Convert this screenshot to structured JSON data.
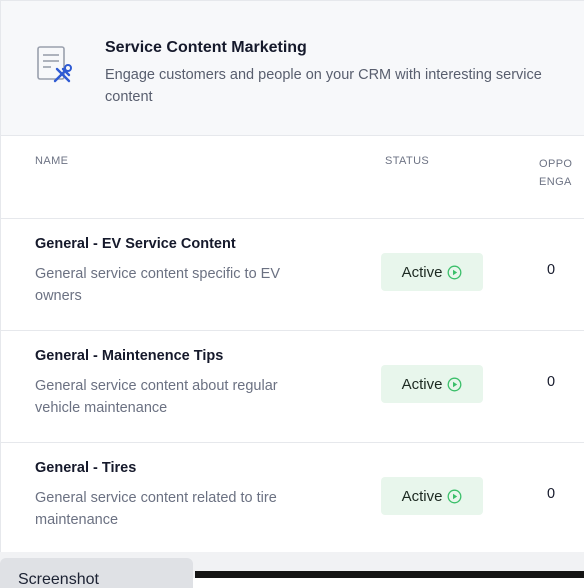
{
  "header": {
    "title": "Service Content Marketing",
    "description": "Engage customers and people on your CRM with interesting service content",
    "icon": "document-tools-icon"
  },
  "table": {
    "columns": [
      "NAME",
      "STATUS",
      "OPPO\nENGA"
    ],
    "rows": [
      {
        "title": "General - EV Service Content",
        "description": "General service content specific to EV owners",
        "status": "Active",
        "count": "0"
      },
      {
        "title": "General - Maintenence Tips",
        "description": "General service content about regular vehicle maintenance",
        "status": "Active",
        "count": "0"
      },
      {
        "title": "General - Tires",
        "description": "General service content related to tire maintenance",
        "status": "Active",
        "count": "0"
      }
    ]
  },
  "tooltip": {
    "label": "Screenshot"
  },
  "colors": {
    "active_bg": "#e8f6ec",
    "active_icon": "#3bbf6a",
    "accent_icon": "#2f5bd3"
  }
}
